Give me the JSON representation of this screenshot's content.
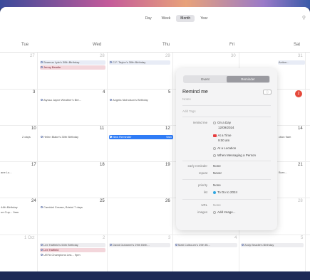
{
  "toolbar": {
    "views": [
      "Day",
      "Week",
      "Month",
      "Year"
    ],
    "search_icon": "magnifier-icon"
  },
  "weekdays": [
    "Tue",
    "Wed",
    "Thu",
    "Fri",
    "Sat"
  ],
  "weeks": [
    {
      "days": [
        "27",
        "28",
        "29",
        "30",
        "31"
      ]
    },
    {
      "days": [
        "3",
        "4",
        "5",
        "6",
        "7"
      ]
    },
    {
      "days": [
        "10",
        "11",
        "12",
        "13",
        "14"
      ]
    },
    {
      "days": [
        "17",
        "18",
        "19",
        "20",
        "21"
      ]
    },
    {
      "days": [
        "24",
        "25",
        "26",
        "27",
        "28"
      ]
    },
    {
      "days": [
        "1 Oct",
        "2",
        "3",
        "4",
        "5"
      ]
    }
  ],
  "badge_count": "2",
  "events": {
    "w0_wed_1": "Seamus Lyle's 30th Birthday",
    "w0_wed_2": "Jenny Beadle",
    "w0_thu_1": "C.F. Taylor's 30th Birthday",
    "w0_sat_1": "Action...",
    "w1_wed_1": "Alyssa Jayne Weather's Birt...",
    "w1_thu_1": "Angela Nicholson's Birthday",
    "w2_tue_1": "2 days",
    "w2_wed_1": "Helen Blake's 30th Birthday",
    "w2_thu_1": "New Reminder",
    "w2_thu_time": "9am",
    "w2_sat_1": "ction",
    "w2_sat_2": "9am",
    "w3_tue_1": "ane Lu...",
    "w3_sat_1": "Burn...",
    "w4_tue_1": "44th Birthday",
    "w4_tue_2": "ue Cup...",
    "w4_tue_3": "9am",
    "w4_wed_1": "Cambial Crease, Bristol",
    "w4_wed_2": "7 days",
    "w5_wed_1": "Lee Hatfield's 54th Birthday",
    "w5_wed_2": "Lee Hatfield",
    "w5_wed_3": "UEFA Champions Lea...",
    "w5_wed_4": "9pm",
    "w5_thu_1": "David Duhamel's 29th Birth...",
    "w5_fri_1": "Matt Colbourn's 29th Bi...",
    "w5_sat_1": "Andy Beadle's Birthday"
  },
  "popover": {
    "tabs": [
      "Event",
      "Reminder"
    ],
    "title": "Remind me",
    "info_label": "ⓘ",
    "notes_placeholder": "Notes",
    "tags_placeholder": "Add Tags",
    "remind_label": "remind me",
    "on_a_day": "On a Day",
    "date": "12/09/2024",
    "at_a_time": "At a Time",
    "time": "9:00 am",
    "at_a_location": "At a Location",
    "when_messaging": "When Messaging a Person",
    "early_label": "early reminder",
    "early_value": "None",
    "repeat_label": "repeat",
    "repeat_value": "Never",
    "priority_label": "priority",
    "priority_value": "None",
    "list_label": "list",
    "list_value": "To Do to 2024",
    "url_label": "URL",
    "url_value": "None",
    "images_label": "images",
    "images_value": "Add Image..."
  }
}
